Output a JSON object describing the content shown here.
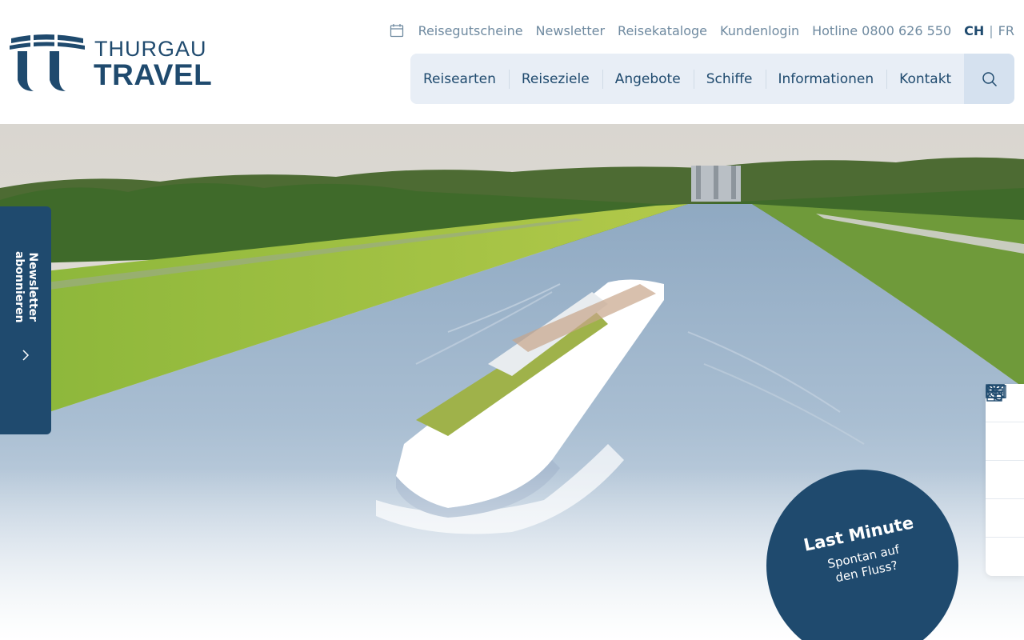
{
  "brand": {
    "name_top": "THURGAU",
    "name_bottom": "TRAVEL",
    "color": "#1f4a6e"
  },
  "topbar": {
    "links": [
      "Reisegutscheine",
      "Newsletter",
      "Reisekataloge",
      "Kundenlogin",
      "Hotline 0800 626 550"
    ],
    "lang_active": "CH",
    "lang_separator": "|",
    "lang_other": "FR"
  },
  "mainnav": {
    "items": [
      "Reisearten",
      "Reiseziele",
      "Angebote",
      "Schiffe",
      "Informationen",
      "Kontakt"
    ]
  },
  "newsletter_tab": {
    "line1": "Newsletter",
    "line2": "abonnieren"
  },
  "side_icons": [
    "mail-icon",
    "phone-icon",
    "catalog-icon",
    "book-icon",
    "gift-icon"
  ],
  "last_minute": {
    "title": "Last Minute",
    "subtitle_line1": "Spontan auf",
    "subtitle_line2": "den Fluss?"
  },
  "colors": {
    "accent": "#1f4a6e",
    "nav_bg": "#e8eef6",
    "search_bg": "#d5e1ef",
    "muted_link": "#6f8aa0"
  }
}
